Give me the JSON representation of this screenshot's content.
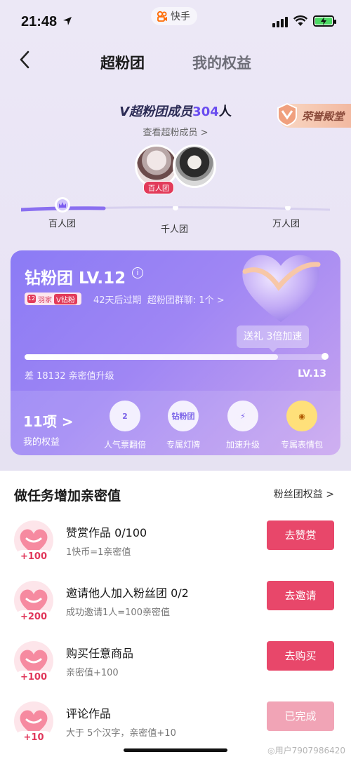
{
  "status_bar": {
    "time": "21:48",
    "app_name": "快手"
  },
  "nav": {
    "tabs": [
      "超粉团",
      "我的权益"
    ],
    "active_tab": "超粉团"
  },
  "header": {
    "member_prefix": "V超粉团成员",
    "member_count": "304",
    "member_suffix": "人",
    "see_members": "查看超粉成员 >",
    "honor_hall": "荣誉殿堂",
    "avatar_tag": "百人团"
  },
  "tiers": {
    "labels": [
      "百人团",
      "千人团",
      "万人团"
    ],
    "current": "百人团"
  },
  "fan_card": {
    "title": "钻粉团 LV.12",
    "badge_brand": "羽家",
    "badge_level": "V钻粉",
    "expire_text": "42天后过期",
    "group_chat": "超粉团群聊: 1个 >",
    "speed_bubble": "送礼 3倍加速",
    "progress_fraction": 0.84,
    "progress_left": "差 18132 亲密值升级",
    "next_level": "LV.13",
    "rights_count": "11项 >",
    "rights_label": "我的权益",
    "rights": [
      {
        "icon": "vote-double-icon",
        "icon_text": "2",
        "label": "人气票翻倍"
      },
      {
        "icon": "exclusive-plate-icon",
        "icon_text": "钻粉团",
        "label": "专属灯牌"
      },
      {
        "icon": "speed-heart-icon",
        "icon_text": "⚡",
        "label": "加速升级"
      },
      {
        "icon": "emoji-pack-icon",
        "icon_text": "◉",
        "label": "专属表情包"
      }
    ]
  },
  "tasks": {
    "title": "做任务增加亲密值",
    "link": "粉丝团权益 >",
    "items": [
      {
        "bonus": "+100",
        "name": "赞赏作品  0/100",
        "desc": "1快币=1亲密值",
        "button": "去赞赏",
        "done": false
      },
      {
        "bonus": "+200",
        "name": "邀请他人加入粉丝团  0/2",
        "desc": "成功邀请1人=100亲密值",
        "button": "去邀请",
        "done": false
      },
      {
        "bonus": "+100",
        "name": "购买任意商品",
        "desc": "亲密值+100",
        "button": "去购买",
        "done": false
      },
      {
        "bonus": "+10",
        "name": "评论作品",
        "desc": "大于 5个汉字，亲密值+10",
        "button": "已完成",
        "done": true
      }
    ]
  },
  "watermark": "◎用户7907986420"
}
